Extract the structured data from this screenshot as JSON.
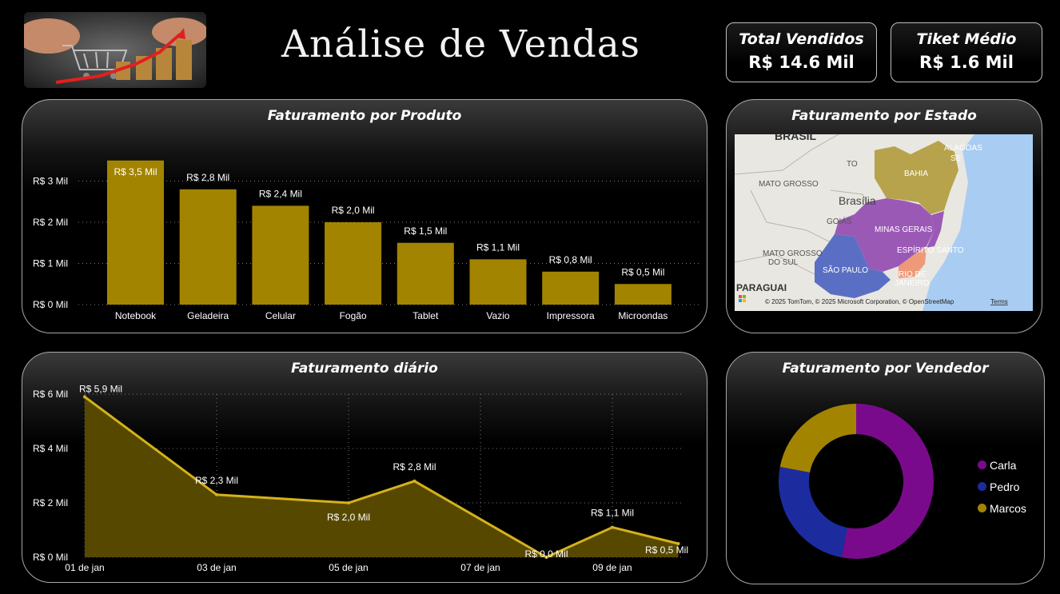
{
  "header": {
    "title": "Análise de Vendas"
  },
  "kpis": {
    "total_label": "Total Vendidos",
    "total_value": "R$ 14.6 Mil",
    "ticket_label": "Tiket Médio",
    "ticket_value": "R$ 1.6 Mil"
  },
  "panels": {
    "produto_title": "Faturamento por Produto",
    "estado_title": "Faturamento por Estado",
    "diario_title": "Faturamento diário",
    "vendedor_title": "Faturamento por Vendedor"
  },
  "map": {
    "labels": [
      "BRASIL",
      "TO",
      "ALAGOAS",
      "SE",
      "BAHIA",
      "MATO GROSSO",
      "Brasília",
      "GOIÁS",
      "MINAS GERAIS",
      "MATO GROSSO",
      "DO SUL",
      "ESPÍRITO SANTO",
      "SÃO PAULO",
      "RIO DE",
      "JANEIRO",
      "PARAGUAI"
    ],
    "attribution": "© 2025 TomTom, © 2025 Microsoft Corporation, © OpenStreetMap",
    "terms": "Terms",
    "region_colors": {
      "bahia": "#b7a34c",
      "minas_gerais": "#9b59b6",
      "sao_paulo": "#5a6fc4",
      "rio_de_janeiro": "#ee9a7a",
      "ocean": "#a9cdf2",
      "land": "#e9e7e1"
    }
  },
  "colors": {
    "bar": "#a38400",
    "line": "#d4b21a",
    "area": "#5c4c00",
    "grid": "#7a7a7a"
  },
  "chart_data": [
    {
      "type": "bar",
      "categories": [
        "Notebook",
        "Geladeira",
        "Celular",
        "Fogão",
        "Tablet",
        "Vazio",
        "Impressora",
        "Microondas"
      ],
      "values": [
        3.5,
        2.8,
        2.4,
        2.0,
        1.5,
        1.1,
        0.8,
        0.5
      ],
      "data_labels": [
        "R$ 3,5 Mil",
        "R$ 2,8 Mil",
        "R$ 2,4 Mil",
        "R$ 2,0 Mil",
        "R$ 1,5 Mil",
        "R$ 1,1 Mil",
        "R$ 0,8 Mil",
        "R$ 0,5 Mil"
      ],
      "y_ticks": [
        0,
        1,
        2,
        3
      ],
      "y_tick_labels": [
        "R$ 0 Mil",
        "R$ 1 Mil",
        "R$ 2 Mil",
        "R$ 3 Mil"
      ],
      "ylim": [
        0,
        3.5
      ],
      "grid": true
    },
    {
      "type": "area",
      "x": [
        "01 de jan",
        "03 de jan",
        "05 de jan",
        "06 de jan",
        "08 de jan",
        "09 de jan",
        "10 de jan"
      ],
      "values": [
        5.9,
        2.3,
        2.0,
        2.8,
        0.0,
        1.1,
        0.5
      ],
      "data_labels": [
        "R$ 5,9 Mil",
        "R$ 2,3 Mil",
        "R$ 2,0 Mil",
        "R$ 2,8 Mil",
        "R$ 0,0 Mil",
        "R$ 1,1 Mil",
        "R$ 0,5 Mil"
      ],
      "x_tick_labels": [
        "01 de jan",
        "03 de jan",
        "05 de jan",
        "07 de jan",
        "09 de jan"
      ],
      "y_ticks": [
        0,
        2,
        4,
        6
      ],
      "y_tick_labels": [
        "R$ 0 Mil",
        "R$ 2 Mil",
        "R$ 4 Mil",
        "R$ 6 Mil"
      ],
      "ylim": [
        0,
        6
      ],
      "grid": true
    },
    {
      "type": "pie",
      "donut": true,
      "categories": [
        "Carla",
        "Pedro",
        "Marcos"
      ],
      "values": [
        53,
        25,
        22
      ],
      "colors": [
        "#7a0a8c",
        "#1c2c9e",
        "#a38400"
      ],
      "legend": "right"
    }
  ]
}
